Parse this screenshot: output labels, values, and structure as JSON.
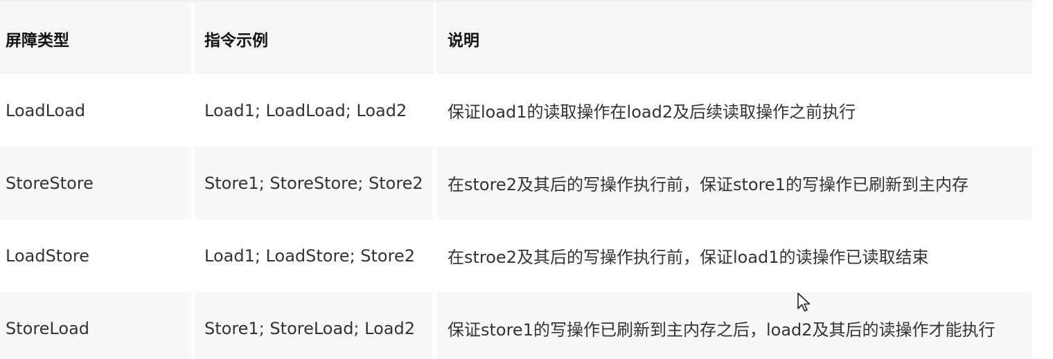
{
  "table": {
    "headers": [
      "屏障类型",
      "指令示例",
      "说明"
    ],
    "rows": [
      {
        "type": "LoadLoad",
        "example": "Load1; LoadLoad; Load2",
        "description": "保证load1的读取操作在load2及后续读取操作之前执行"
      },
      {
        "type": "StoreStore",
        "example": "Store1; StoreStore; Store2",
        "description": "在store2及其后的写操作执行前，保证store1的写操作已刷新到主内存"
      },
      {
        "type": "LoadStore",
        "example": "Load1; LoadStore; Store2",
        "description": "在stroe2及其后的写操作执行前，保证load1的读操作已读取结束"
      },
      {
        "type": "StoreLoad",
        "example": "Store1; StoreLoad; Load2",
        "description": "保证store1的写操作已刷新到主内存之后，load2及其后的读操作才能执行"
      }
    ]
  },
  "cursor": {
    "icon": "mouse-pointer-icon"
  }
}
